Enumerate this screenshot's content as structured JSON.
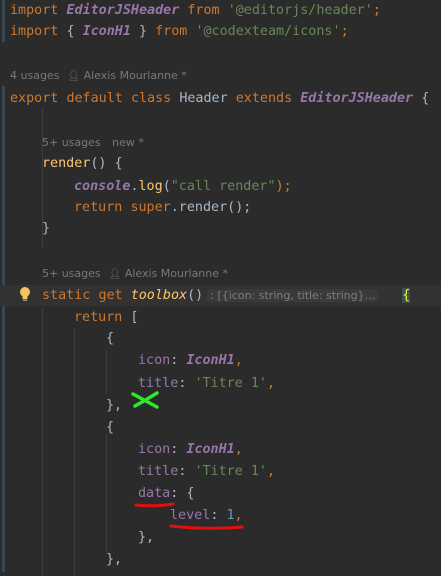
{
  "code": {
    "import1": {
      "kw1": "import",
      "name": "EditorJSHeader",
      "kw2": "from",
      "path": "'@editorjs/header'",
      "semi": ";"
    },
    "import2": {
      "kw1": "import",
      "open": "{ ",
      "name": "IconH1",
      "close": " }",
      "kw2": "from",
      "path": "'@codexteam/icons'",
      "semi": ";"
    },
    "hint_class": {
      "usages": "4 usages",
      "author": "Alexis Mourlanne *"
    },
    "class_decl": {
      "kw1": "export",
      "kw2": "default",
      "kw3": "class",
      "name": "Header",
      "kw4": "extends",
      "parent": "EditorJSHeader",
      "brace": "{"
    },
    "hint_render": {
      "usages": "5+ usages",
      "status": "new *"
    },
    "render_decl": {
      "name": "render",
      "rest": "() {"
    },
    "console_line": {
      "obj": "console",
      "dot": ".",
      "method": "log",
      "open": "(",
      "arg": "\"call render\"",
      "close": ");"
    },
    "return_super": {
      "kw": "return",
      "sup": "super",
      "rest": ".render();"
    },
    "close_render": "}",
    "hint_toolbox": {
      "usages": "5+ usages",
      "author": "Alexis Mourlanne *"
    },
    "toolbox_decl": {
      "kw1": "static",
      "kw2": "get",
      "name": "toolbox",
      "paren": "()",
      "type_hint": ": [{icon: string, title: string}...",
      "brace": "{"
    },
    "return_bracket": {
      "kw": "return",
      "rest": " ["
    },
    "obj1_open": "{",
    "obj1_icon": {
      "key": "icon",
      "colon": ": ",
      "value": "IconH1",
      "comma": ","
    },
    "obj1_title": {
      "key": "title",
      "colon": ": ",
      "value": "'Titre 1'",
      "comma": ","
    },
    "obj1_close": "},",
    "obj2_open": "{",
    "obj2_icon": {
      "key": "icon",
      "colon": ": ",
      "value": "IconH1",
      "comma": ","
    },
    "obj2_title": {
      "key": "title",
      "colon": ": ",
      "value": "'Titre 1'",
      "comma": ","
    },
    "obj2_data": {
      "key": "data",
      "rest": ": {"
    },
    "obj2_level": {
      "key": "level",
      "colon": ": ",
      "value": "1",
      "comma": ","
    },
    "obj2_data_close": "},",
    "obj2_close": "},"
  },
  "icons": {
    "user": "user-icon",
    "bulb": "lightbulb-icon"
  },
  "colors": {
    "background": "#2b2b2b",
    "keyword": "#cc7832",
    "string": "#6a8759",
    "property": "#9876aa",
    "function": "#ffc66d",
    "number": "#6897bb",
    "green_mark": "#2ee82e",
    "red_mark": "#e01010"
  }
}
